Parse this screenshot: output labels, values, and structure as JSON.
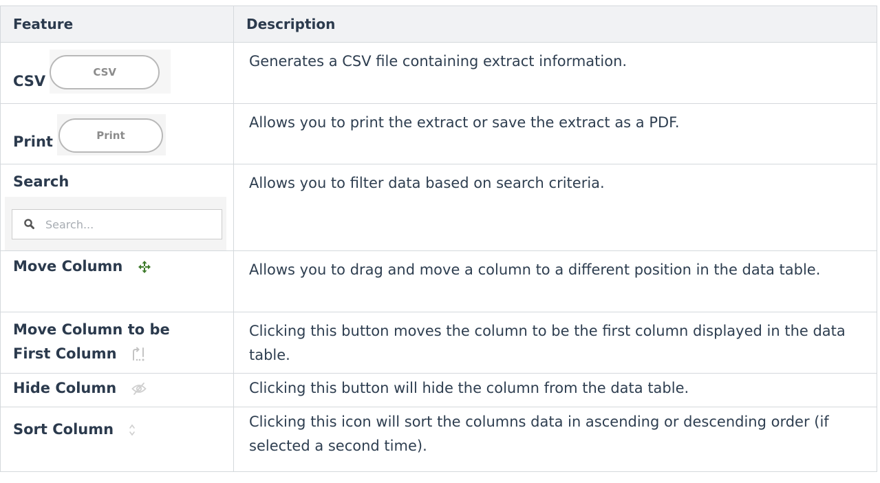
{
  "table": {
    "headers": {
      "feature": "Feature",
      "description": "Description"
    },
    "rows": [
      {
        "feature": "CSV",
        "button": "CSV",
        "description": "Generates a CSV file containing extract information."
      },
      {
        "feature": "Print",
        "button": "Print",
        "description": "Allows you to print the extract or save the extract as a PDF."
      },
      {
        "feature": "Search",
        "placeholder": "Search...",
        "description": "Allows you to filter data based on search criteria."
      },
      {
        "feature": "Move Column",
        "icon": "move-arrows-icon",
        "description": "Allows you to drag and move a column to a different position in the data table."
      },
      {
        "feature_line1": "Move Column to be",
        "feature_line2": "First Column",
        "icon": "move-first-icon",
        "description": "Clicking this button moves the column to be the first column displayed in the data table."
      },
      {
        "feature": "Hide Column",
        "icon": "eye-slash-icon",
        "description": "Clicking this button will hide the column from the data table."
      },
      {
        "feature": "Sort Column",
        "icon": "sort-icon",
        "description": "Clicking this icon will sort the columns data in ascending or descending order (if selected a second time)."
      }
    ]
  },
  "colors": {
    "header_bg": "#f1f2f4",
    "border": "#d4d8dc",
    "text": "#2e3e50",
    "move_icon": "#3d7a2a"
  }
}
